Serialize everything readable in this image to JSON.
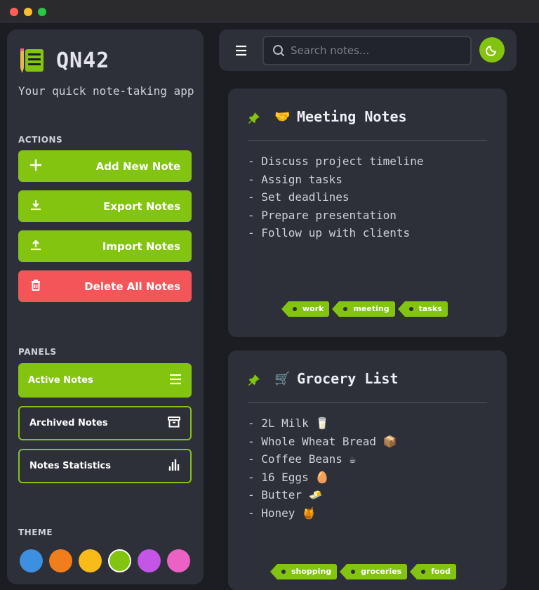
{
  "window": {
    "buttons": [
      "close",
      "minimize",
      "maximize"
    ],
    "colors": [
      "#ff5f57",
      "#febc2e",
      "#28c840"
    ]
  },
  "sidebar": {
    "app_name": "QN42",
    "tagline": "Your quick note-taking app",
    "actions_label": "ACTIONS",
    "actions": [
      {
        "label": "Add New Note",
        "icon": "plus-icon"
      },
      {
        "label": "Export Notes",
        "icon": "download-icon"
      },
      {
        "label": "Import Notes",
        "icon": "upload-icon"
      },
      {
        "label": "Delete All Notes",
        "icon": "trash-icon"
      }
    ],
    "panels_label": "PANELS",
    "panels": [
      {
        "label": "Active Notes",
        "icon": "list-icon",
        "active": true
      },
      {
        "label": "Archived Notes",
        "icon": "archive-icon",
        "active": false
      },
      {
        "label": "Notes Statistics",
        "icon": "bar-chart-icon",
        "active": false
      }
    ],
    "theme_label": "THEME",
    "themes": [
      "#3d8fe0",
      "#f07f1b",
      "#f8bb18",
      "#82c40f",
      "#c455e6",
      "#eb62c4"
    ],
    "selected_theme": "#82c40f"
  },
  "topbar": {
    "menu_icon": "hamburger-icon",
    "search_placeholder": "Search notes...",
    "search_value": "",
    "theme_toggle_icon": "moon-icon"
  },
  "notes": [
    {
      "title": "Meeting Notes",
      "emoji": "🤝",
      "pinned": true,
      "lines": [
        "- Discuss project timeline",
        "- Assign tasks",
        "- Set deadlines",
        "- Prepare presentation",
        "- Follow up with clients"
      ],
      "tags": [
        "work",
        "meeting",
        "tasks"
      ]
    },
    {
      "title": "Grocery List",
      "emoji": "🛒",
      "pinned": true,
      "lines": [
        "- 2L Milk 🥛",
        "- Whole Wheat Bread 📦",
        "- Coffee Beans ☕",
        "- 16 Eggs 🥚",
        "- Butter 🧈",
        "- Honey 🍯"
      ],
      "tags": [
        "shopping",
        "groceries",
        "food"
      ]
    }
  ],
  "accent": "#82c40f",
  "danger": "#f45558"
}
